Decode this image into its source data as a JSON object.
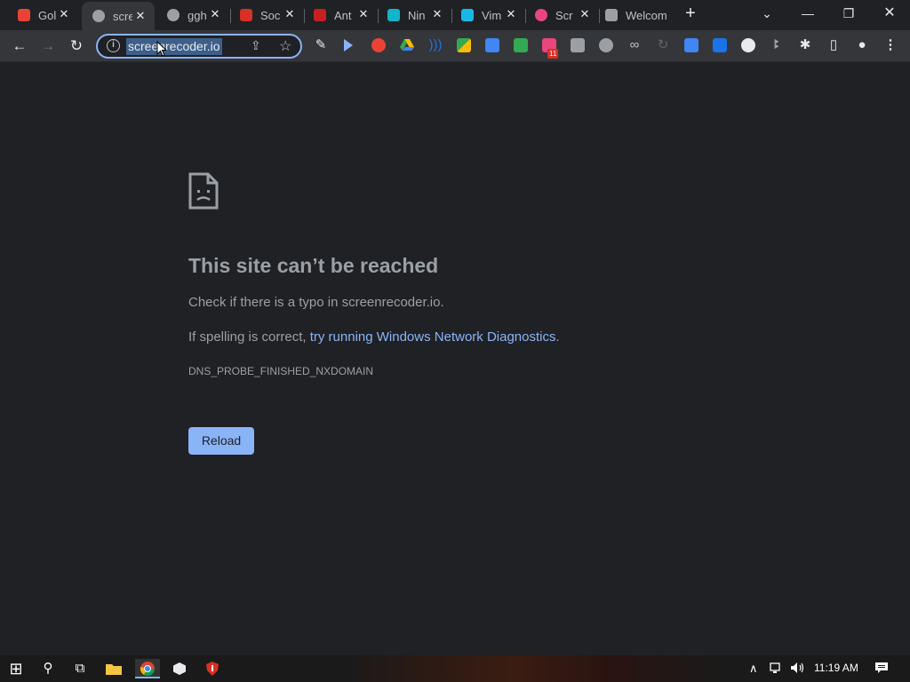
{
  "tabs": [
    {
      "title": "Gol",
      "favicon_color": "#ea4335",
      "active": false
    },
    {
      "title": "scre",
      "favicon_color": "#9aa0a6",
      "active": true
    },
    {
      "title": "ggh",
      "favicon_color": "#9aa0a6",
      "active": false
    },
    {
      "title": "Soc",
      "favicon_color": "#d93025",
      "active": false
    },
    {
      "title": "Ant",
      "favicon_color": "#c5221f",
      "active": false
    },
    {
      "title": "Nin",
      "favicon_color": "#12b5cb",
      "active": false
    },
    {
      "title": "Vim",
      "favicon_color": "#1ab7ea",
      "active": false
    },
    {
      "title": "Scr",
      "favicon_color": "#e8467c",
      "active": false
    },
    {
      "title": "Welcom",
      "favicon_color": "#9aa0a6",
      "active": false
    }
  ],
  "tab_close_glyph": "✕",
  "new_tab_glyph": "+",
  "window_controls": {
    "tab_search": "⌄",
    "minimize": "—",
    "restore": "❐",
    "close": "✕"
  },
  "nav": {
    "back": "←",
    "forward": "→",
    "reload": "↻"
  },
  "omnibox": {
    "url": "screenrecoder.io",
    "info_glyph": "i",
    "share_glyph": "⇪",
    "star_glyph": "☆"
  },
  "extension_badge": "11",
  "extensions": [
    {
      "icon": "pen-icon",
      "color": "#9aa0a6"
    },
    {
      "icon": "cursor-icon",
      "color": "#8ab4f8"
    },
    {
      "icon": "red-circle-icon",
      "color": "#ea4335"
    },
    {
      "icon": "google-drive-icon",
      "color": "#34a853"
    },
    {
      "icon": "wave-icon",
      "color": "#1a73e8"
    },
    {
      "icon": "grid-icon",
      "color": "#fbbc04"
    },
    {
      "icon": "translate-icon",
      "color": "#4285f4"
    },
    {
      "icon": "image-icon",
      "color": "#34a853"
    },
    {
      "icon": "badge-ext-icon",
      "color": "#e8467c"
    },
    {
      "icon": "calendar-icon",
      "color": "#9aa0a6"
    },
    {
      "icon": "grey-dot-icon",
      "color": "#9aa0a6"
    },
    {
      "icon": "glasses-icon",
      "color": "#bdc1c6"
    },
    {
      "icon": "arc-icon",
      "color": "#5f6368"
    },
    {
      "icon": "screen-icon",
      "color": "#4285f4"
    },
    {
      "icon": "bookmark-ext-icon",
      "color": "#1a73e8"
    },
    {
      "icon": "wordpress-icon",
      "color": "#e8eaed"
    },
    {
      "icon": "people-icon",
      "color": "#9aa0a6"
    }
  ],
  "toolbar_right": {
    "puzzle": "✱",
    "sidepanel": "▯",
    "profile": "●",
    "menu": "⋮"
  },
  "error": {
    "heading": "This site can’t be reached",
    "line1": "Check if there is a typo in screenrecoder.io.",
    "line2_prefix": "If spelling is correct, ",
    "line2_link": "try running Windows Network Diagnostics",
    "line2_suffix": ".",
    "code": "DNS_PROBE_FINISHED_NXDOMAIN",
    "reload_label": "Reload"
  },
  "taskbar": {
    "start_glyph": "⊞",
    "search_glyph": "⚲",
    "taskview_glyph": "⧉",
    "tray_chevron": "∧",
    "clock": "11:19 AM",
    "notification_glyph": "▤"
  },
  "colors": {
    "accent": "#8ab4f8",
    "background": "#202124",
    "toolbar": "#35363a"
  }
}
